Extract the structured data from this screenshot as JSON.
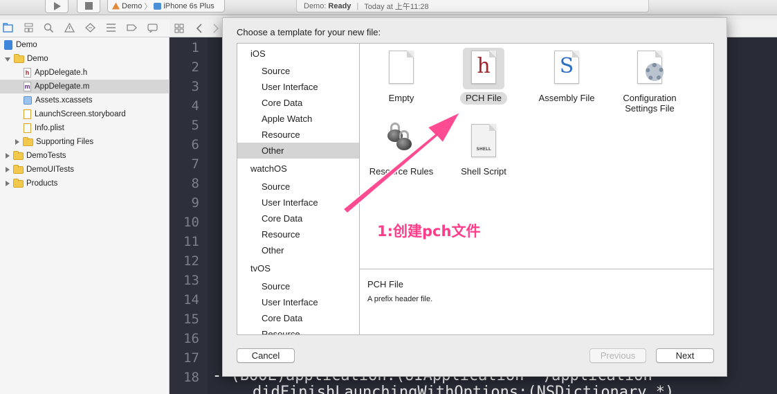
{
  "toolbar": {
    "scheme": "Demo",
    "device": "iPhone 6s Plus",
    "status_project": "Demo:",
    "status_state": "Ready",
    "status_time": "Today at 上午11:28"
  },
  "navigator": {
    "items": [
      {
        "label": "Demo"
      },
      {
        "label": "Demo"
      },
      {
        "label": "AppDelegate.h",
        "badge": "h"
      },
      {
        "label": "AppDelegate.m",
        "badge": "m"
      },
      {
        "label": "Assets.xcassets"
      },
      {
        "label": "LaunchScreen.storyboard"
      },
      {
        "label": "Info.plist"
      },
      {
        "label": "Supporting Files"
      },
      {
        "label": "DemoTests"
      },
      {
        "label": "DemoUITests"
      },
      {
        "label": "Products"
      }
    ]
  },
  "editor": {
    "line_numbers": [
      "1",
      "2",
      "3",
      "4",
      "5",
      "6",
      "7",
      "8",
      "9",
      "10",
      "11",
      "12",
      "13",
      "14",
      "15",
      "16",
      "17",
      "18"
    ],
    "line18": "- (BOOL)application:(UIApplication *)application",
    "line19": "didFinishLaunchingWithOptions:(NSDictionary *)"
  },
  "sheet": {
    "title": "Choose a template for your new file:",
    "groups": [
      {
        "name": "iOS",
        "items": [
          "Source",
          "User Interface",
          "Core Data",
          "Apple Watch",
          "Resource",
          "Other"
        ]
      },
      {
        "name": "watchOS",
        "items": [
          "Source",
          "User Interface",
          "Core Data",
          "Resource",
          "Other"
        ]
      },
      {
        "name": "tvOS",
        "items": [
          "Source",
          "User Interface",
          "Core Data",
          "Resource"
        ]
      }
    ],
    "templates": [
      {
        "label": "Empty",
        "label2": ""
      },
      {
        "label": "PCH File",
        "label2": "",
        "glyph": "h"
      },
      {
        "label": "Assembly File",
        "label2": "",
        "glyph": "S"
      },
      {
        "label": "Configuration",
        "label2": "Settings File"
      },
      {
        "label": "Resource Rules",
        "label2": ""
      },
      {
        "label": "Shell Script",
        "label2": "",
        "glyph": "SHELL"
      }
    ],
    "description_title": "PCH File",
    "description_text": "A prefix header file.",
    "buttons": {
      "cancel": "Cancel",
      "previous": "Previous",
      "next": "Next"
    }
  },
  "annotation": {
    "text": "1:创建pch文件",
    "color": "#ff3d8a"
  }
}
